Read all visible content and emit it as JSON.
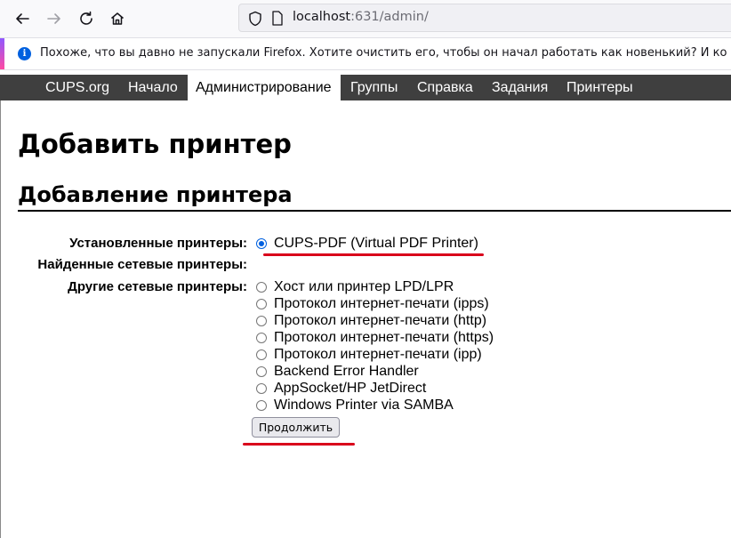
{
  "browser": {
    "url_host": "localhost",
    "url_rest": ":631/admin/",
    "notification": "Похоже, что вы давно не запускали Firefox. Хотите очистить его, чтобы он начал работать как новенький? И ко"
  },
  "nav": {
    "items": [
      "CUPS.org",
      "Начало",
      "Администрирование",
      "Группы",
      "Справка",
      "Задания",
      "Принтеры"
    ],
    "active": "Администрирование"
  },
  "page": {
    "title": "Добавить принтер",
    "section_title": "Добавление принтера"
  },
  "form": {
    "installed_label": "Установленные принтеры:",
    "discovered_label": "Найденные сетевые принтеры:",
    "other_label": "Другие сетевые принтеры:",
    "installed_options": [
      "CUPS-PDF (Virtual PDF Printer)"
    ],
    "other_options": [
      "Хост или принтер LPD/LPR",
      "Протокол интернет-печати (ipps)",
      "Протокол интернет-печати (http)",
      "Протокол интернет-печати (https)",
      "Протокол интернет-печати (ipp)",
      "Backend Error Handler",
      "AppSocket/HP JetDirect",
      "Windows Printer via SAMBA"
    ],
    "selected": "CUPS-PDF (Virtual PDF Printer)",
    "submit_label": "Продолжить"
  },
  "colors": {
    "nav_bg": "#3f3f3f",
    "annotation_red": "#d9001b",
    "radio_selected": "#0060df"
  }
}
